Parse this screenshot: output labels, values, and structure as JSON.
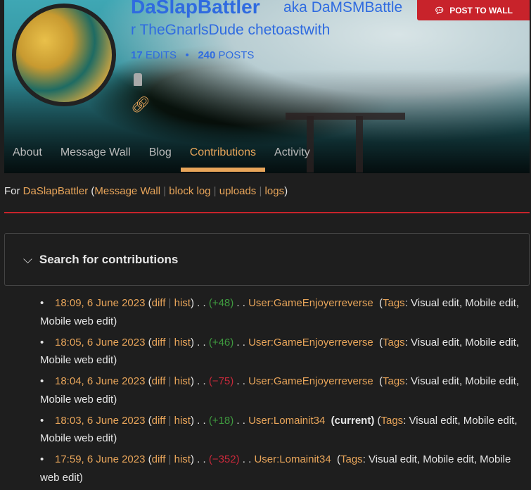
{
  "profile": {
    "name": "DaSlapBattler",
    "aka_line1": "aka DaMSMBattle",
    "aka_line2": "r TheGnarlsDude chetoastwith",
    "edits_count": "17",
    "edits_label": "EDITS",
    "posts_count": "240",
    "posts_label": "POSTS",
    "post_button": "POST TO WALL"
  },
  "tabs": [
    "About",
    "Message Wall",
    "Blog",
    "Contributions",
    "Activity"
  ],
  "for_line": {
    "prefix": "For",
    "user": "DaSlapBattler",
    "links": [
      "Message Wall",
      "block log",
      "uploads",
      "logs"
    ]
  },
  "search_label": "Search for contributions",
  "contributions": [
    {
      "time": "18:09, 6 June 2023",
      "diff": "diff",
      "hist": "hist",
      "size": "(+48)",
      "sign": "pos",
      "page": "User:GameEnjoyerreverse",
      "current": "",
      "tags_label": "Tags",
      "tags": ": Visual edit, Mobile edit, Mobile web edit)"
    },
    {
      "time": "18:05, 6 June 2023",
      "diff": "diff",
      "hist": "hist",
      "size": "(+46)",
      "sign": "pos",
      "page": "User:GameEnjoyerreverse",
      "current": "",
      "tags_label": "Tags",
      "tags": ": Visual edit, Mobile edit, Mobile web edit)"
    },
    {
      "time": "18:04, 6 June 2023",
      "diff": "diff",
      "hist": "hist",
      "size": "(−75)",
      "sign": "neg",
      "page": "User:GameEnjoyerreverse",
      "current": "",
      "tags_label": "Tags",
      "tags": ": Visual edit, Mobile edit, Mobile web edit)"
    },
    {
      "time": "18:03, 6 June 2023",
      "diff": "diff",
      "hist": "hist",
      "size": "(+18)",
      "sign": "pos",
      "page": "User:Lomainit34",
      "current": "(current)",
      "tags_label": "Tags",
      "tags": ": Visual edit, Mobile edit, Mobile web edit)"
    },
    {
      "time": "17:59, 6 June 2023",
      "diff": "diff",
      "hist": "hist",
      "size": "(−352)",
      "sign": "neg",
      "page": "User:Lomainit34",
      "current": "",
      "tags_label": "Tags",
      "tags": ": Visual edit, Mobile edit, Mobile web edit)"
    }
  ]
}
